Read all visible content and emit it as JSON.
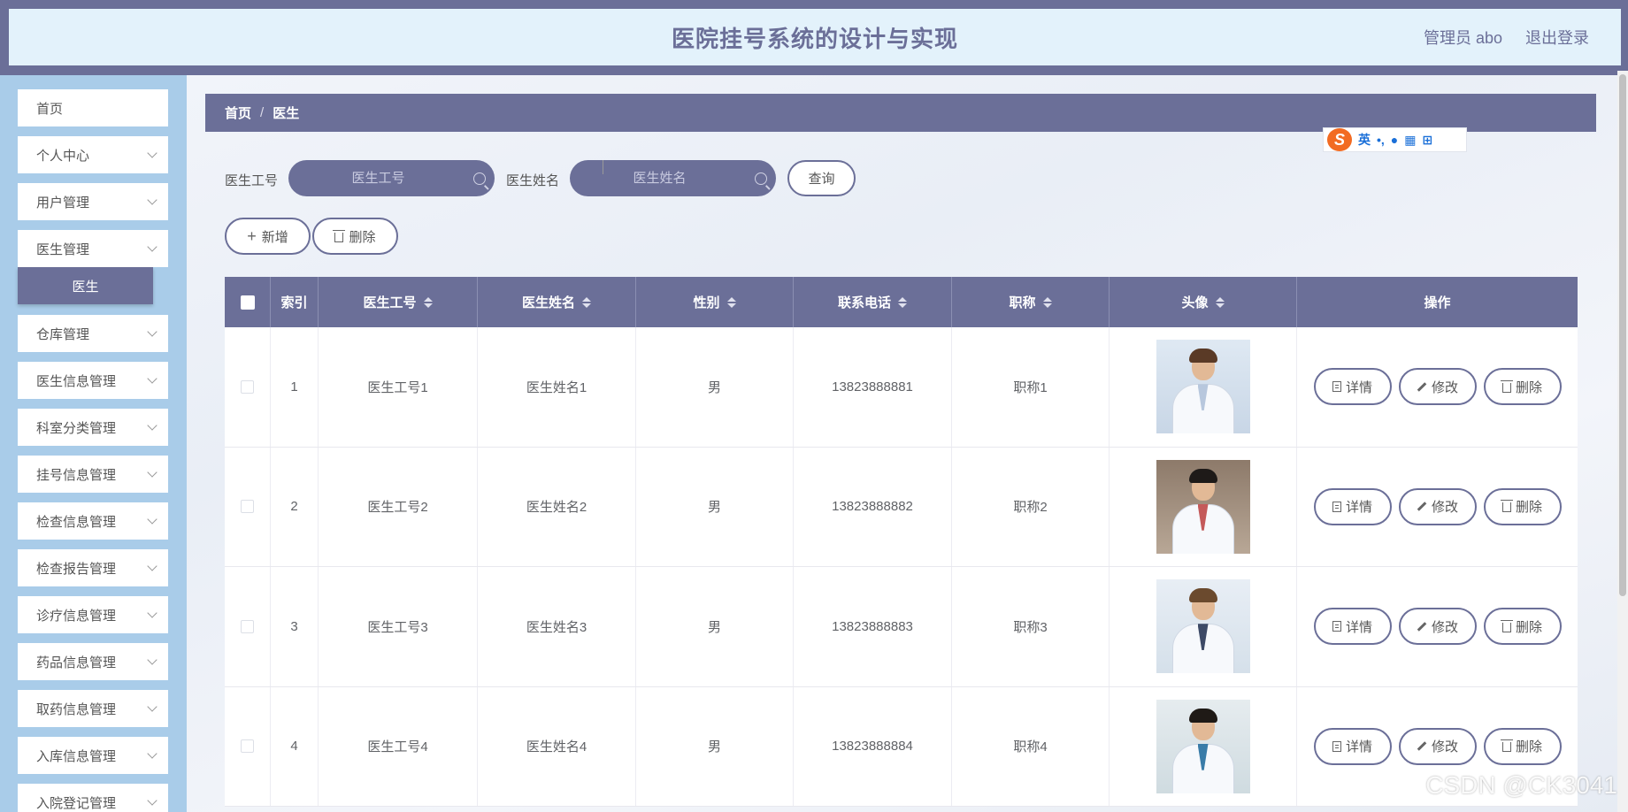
{
  "header": {
    "title": "医院挂号系统的设计与实现",
    "user_label": "管理员 abo",
    "logout": "退出登录"
  },
  "sidebar": {
    "items": [
      {
        "label": "首页",
        "has_arrow": false
      },
      {
        "label": "个人中心",
        "has_arrow": true
      },
      {
        "label": "用户管理",
        "has_arrow": true
      },
      {
        "label": "医生管理",
        "has_arrow": true
      },
      {
        "label": "仓库管理",
        "has_arrow": true
      },
      {
        "label": "医生信息管理",
        "has_arrow": true
      },
      {
        "label": "科室分类管理",
        "has_arrow": true
      },
      {
        "label": "挂号信息管理",
        "has_arrow": true
      },
      {
        "label": "检查信息管理",
        "has_arrow": true
      },
      {
        "label": "检查报告管理",
        "has_arrow": true
      },
      {
        "label": "诊疗信息管理",
        "has_arrow": true
      },
      {
        "label": "药品信息管理",
        "has_arrow": true
      },
      {
        "label": "取药信息管理",
        "has_arrow": true
      },
      {
        "label": "入库信息管理",
        "has_arrow": true
      },
      {
        "label": "入院登记管理",
        "has_arrow": true
      }
    ],
    "active_sub": "医生"
  },
  "breadcrumb": {
    "home": "首页",
    "separator": "/",
    "current": "医生"
  },
  "ime": {
    "lang": "英",
    "punct": "•,"
  },
  "search": {
    "field1_label": "医生工号",
    "field1_placeholder": "医生工号",
    "field2_label": "医生姓名",
    "field2_placeholder": "医生姓名",
    "query_button": "查询"
  },
  "actions": {
    "add": "新增",
    "delete": "删除"
  },
  "table": {
    "columns": [
      "索引",
      "医生工号",
      "医生姓名",
      "性别",
      "联系电话",
      "职称",
      "头像",
      "操作"
    ],
    "rows": [
      {
        "index": "1",
        "id": "医生工号1",
        "name": "医生姓名1",
        "gender": "男",
        "phone": "13823888881",
        "title": "职称1"
      },
      {
        "index": "2",
        "id": "医生工号2",
        "name": "医生姓名2",
        "gender": "男",
        "phone": "13823888882",
        "title": "职称2"
      },
      {
        "index": "3",
        "id": "医生工号3",
        "name": "医生姓名3",
        "gender": "男",
        "phone": "13823888883",
        "title": "职称3"
      },
      {
        "index": "4",
        "id": "医生工号4",
        "name": "医生姓名4",
        "gender": "男",
        "phone": "13823888884",
        "title": "职称4"
      }
    ],
    "row_actions": {
      "detail": "详情",
      "edit": "修改",
      "delete": "删除"
    }
  },
  "watermark": "CSDN @CK3041",
  "colors": {
    "primary": "#6b6f98",
    "header_bg": "#e3f2fb",
    "sidebar_bg": "#a9cce9"
  }
}
